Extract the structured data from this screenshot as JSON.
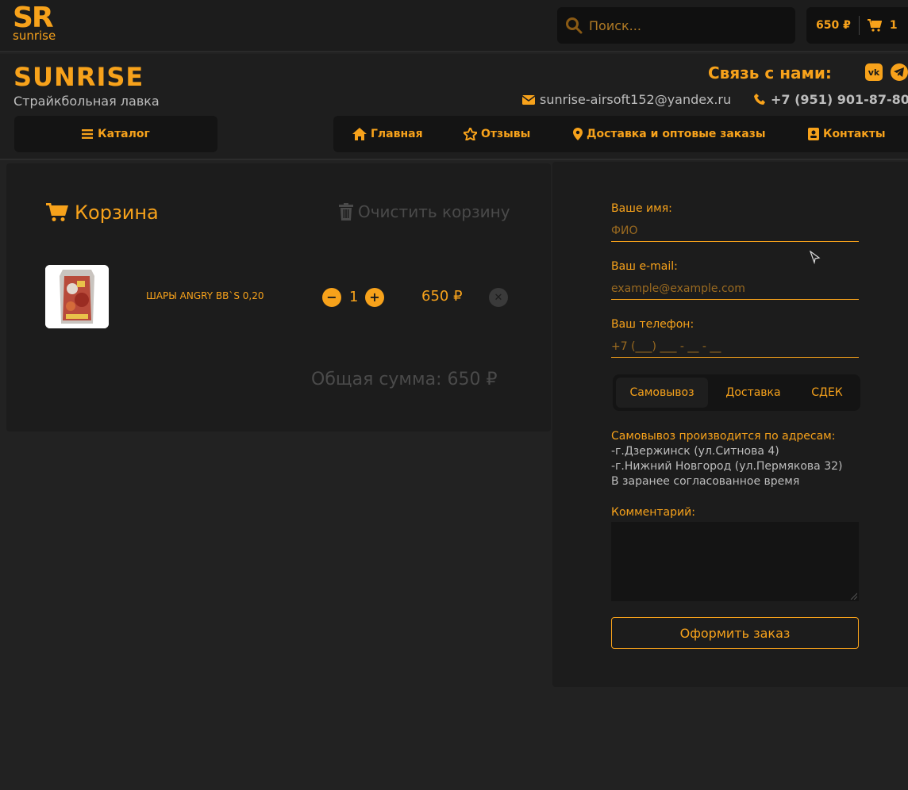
{
  "logo": {
    "main": "SR",
    "sub": "sunrise"
  },
  "search": {
    "placeholder": "Поиск..."
  },
  "topcart": {
    "amount": "650 ₽",
    "count": "1"
  },
  "brand": {
    "name": "SUNRISE",
    "tagline": "Страйкбольная лавка"
  },
  "contacts": {
    "title": "Связь с нами:",
    "email": "sunrise-airsoft152@yandex.ru",
    "phone": "+7 (951) 901-87-80",
    "vk_icon": "vk-icon",
    "tg_icon": "telegram-icon"
  },
  "nav": {
    "catalog": "Каталог",
    "items": [
      {
        "label": "Главная",
        "icon": "home-icon"
      },
      {
        "label": "Отзывы",
        "icon": "star-icon"
      },
      {
        "label": "Доставка и оптовые заказы",
        "icon": "map-pin-icon"
      },
      {
        "label": "Контакты",
        "icon": "contact-card-icon"
      }
    ]
  },
  "cart": {
    "title": "Корзина",
    "clear": "Очистить корзину",
    "items": [
      {
        "name": "ШАРЫ ANGRY BB`S 0,20",
        "qty": "1",
        "price": "650 ₽"
      }
    ],
    "total": "Общая сумма: 650 ₽"
  },
  "form": {
    "name_label": "Ваше имя:",
    "name_placeholder": "ФИО",
    "email_label": "Ваш e-mail:",
    "email_placeholder": "example@example.com",
    "phone_label": "Ваш телефон:",
    "phone_placeholder": "+7 (___) ___ - __ - __",
    "tabs": [
      "Самовывоз",
      "Доставка",
      "СДЕК"
    ],
    "active_tab": "Самовывоз",
    "pickup_head": "Самовывоз производится по адресам:",
    "pickup_lines": [
      "-г.Дзержинск (ул.Ситнова 4)",
      "-г.Нижний Новгород (ул.Пермякова 32)",
      "В заранее согласованное время"
    ],
    "comment_label": "Комментарий:",
    "submit": "Оформить заказ"
  },
  "colors": {
    "accent": "#f7a21b",
    "background": "#222222",
    "panel": "#1c1c1c",
    "muted": "#bdbdbd"
  }
}
